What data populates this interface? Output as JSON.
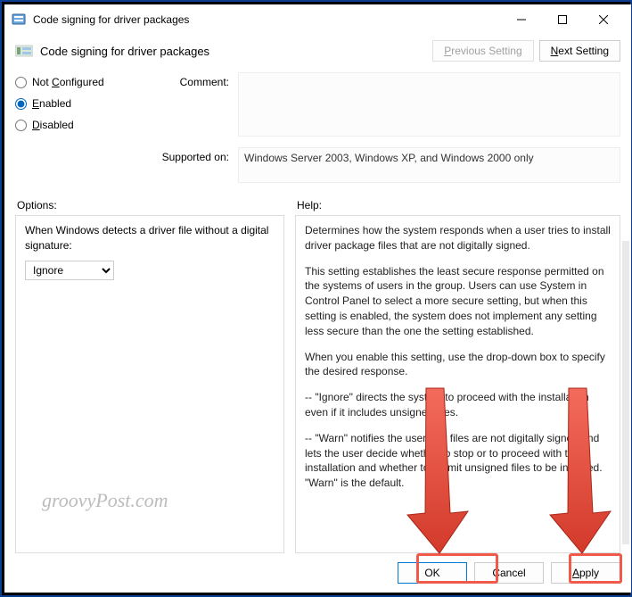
{
  "window": {
    "title": "Code signing for driver packages",
    "header_title": "Code signing for driver packages"
  },
  "nav": {
    "previous": "Previous Setting",
    "next": "Next Setting"
  },
  "radios": {
    "not_configured": "Not Configured",
    "enabled": "Enabled",
    "disabled": "Disabled",
    "selected": "Enabled"
  },
  "fields": {
    "comment_label": "Comment:",
    "comment_value": "",
    "supported_label": "Supported on:",
    "supported_value": "Windows Server 2003, Windows XP, and Windows 2000 only"
  },
  "sections": {
    "options_label": "Options:",
    "help_label": "Help:"
  },
  "options": {
    "prompt": "When Windows detects a driver file without a digital signature:",
    "select_value": "Ignore"
  },
  "help": {
    "p1": "Determines how the system responds when a user tries to install driver package files that are not digitally signed.",
    "p2": "This setting establishes the least secure response permitted on the systems of users in the group. Users can use System in Control Panel to select a more secure setting, but when this setting is enabled, the system does not implement any setting less secure than the one the setting established.",
    "p3": "When you enable this setting, use the drop-down box to specify the desired response.",
    "p4": "--   \"Ignore\" directs the system to proceed with the installation even if it includes unsigned files.",
    "p5": "--   \"Warn\" notifies the user that files are not digitally signed and lets the user decide whether to stop or to proceed with the installation and whether to permit unsigned files to be installed. \"Warn\" is the default."
  },
  "buttons": {
    "ok": "OK",
    "cancel": "Cancel",
    "apply": "Apply"
  },
  "watermark": "groovyPost.com"
}
